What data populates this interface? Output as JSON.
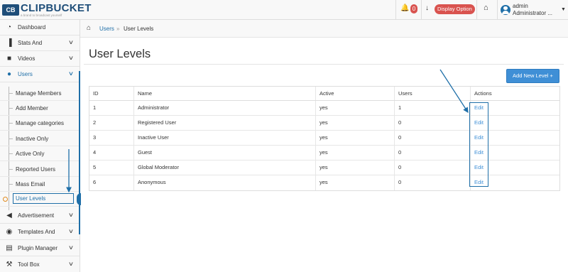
{
  "app": {
    "logo_mark": "CB",
    "logo_name": "CLIPBUCKET",
    "logo_tagline": "a brand to broadcast yourself",
    "brand_color": "#1f4e79",
    "accent_color": "#1f6fa8"
  },
  "topbar": {
    "notification_count": "0",
    "display_option_label": "Display Option",
    "user_name": "admin",
    "user_role": "Administrator ...",
    "icons": [
      "bell-icon",
      "download-icon",
      "home-icon",
      "user-avatar-icon",
      "caret-down-icon"
    ]
  },
  "sidebar": {
    "items": [
      {
        "label": "Dashboard",
        "icon": "dashboard-icon"
      },
      {
        "label": "Stats And",
        "icon": "bar-chart-icon"
      },
      {
        "label": "Videos",
        "icon": "video-camera-icon"
      },
      {
        "label": "Users",
        "icon": "user-icon"
      },
      {
        "label": "Advertisement",
        "icon": "megaphone-icon"
      },
      {
        "label": "Templates And",
        "icon": "circle-icon"
      },
      {
        "label": "Plugin Manager",
        "icon": "plugin-icon"
      },
      {
        "label": "Tool Box",
        "icon": "wrench-icon"
      }
    ],
    "users_submenu": [
      "Manage Members",
      "Add Member",
      "Manage categories",
      "Inactive Only",
      "Active Only",
      "Reported Users",
      "Mass Email",
      "User Levels"
    ],
    "active_section": "Users",
    "current_page": "User Levels"
  },
  "breadcrumb": {
    "link": "Users",
    "separator": "»",
    "current": "User Levels"
  },
  "page": {
    "title": "User Levels",
    "add_button_label": "Add New Level +"
  },
  "table": {
    "columns": [
      "ID",
      "Name",
      "Active",
      "Users",
      "Actions"
    ],
    "rows": [
      {
        "id": "1",
        "name": "Administrator",
        "active": "yes",
        "users": "1",
        "action": "Edit"
      },
      {
        "id": "2",
        "name": "Registered User",
        "active": "yes",
        "users": "0",
        "action": "Edit"
      },
      {
        "id": "3",
        "name": "Inactive User",
        "active": "yes",
        "users": "0",
        "action": "Edit"
      },
      {
        "id": "4",
        "name": "Guest",
        "active": "yes",
        "users": "0",
        "action": "Edit"
      },
      {
        "id": "5",
        "name": "Global Moderator",
        "active": "yes",
        "users": "0",
        "action": "Edit"
      },
      {
        "id": "6",
        "name": "Anonymous",
        "active": "yes",
        "users": "0",
        "action": "Edit"
      }
    ]
  }
}
